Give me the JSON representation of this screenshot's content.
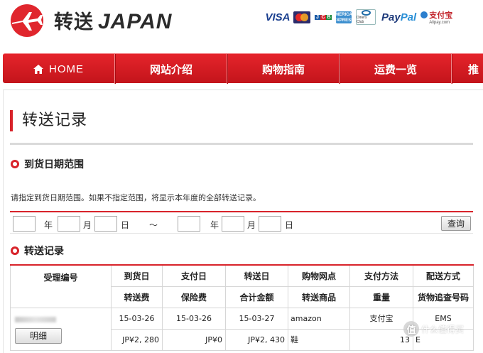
{
  "header": {
    "logo_cn": "转送",
    "logo_en": "JAPAN",
    "payments": {
      "visa": "VISA",
      "jcb": [
        "J",
        "C",
        "B"
      ],
      "amex": "AMERICAN EXPRESS",
      "diners": "Diners Club",
      "paypal_1": "Pay",
      "paypal_2": "Pal",
      "alipay": "支付宝",
      "alipay_sub": "Alipay.com"
    }
  },
  "nav": {
    "items": [
      "HOME",
      "网站介绍",
      "购物指南",
      "运费一览",
      "推"
    ]
  },
  "page": {
    "title": "转送记录",
    "date_section": "到货日期范围",
    "hint": "请指定到货日期范围。如果不指定范围，将显示本年度的全部转送记录。",
    "date_labels": {
      "year": "年",
      "month": "月",
      "day": "日",
      "tilde": "～"
    },
    "search_button": "查询",
    "records_section": "转送记录"
  },
  "table": {
    "header_row1": [
      "受理编号",
      "到货日",
      "支付日",
      "转送日",
      "购物网点",
      "支付方法",
      "配送方式"
    ],
    "header_row2": [
      "转送费",
      "保险费",
      "合计金额",
      "转送商品",
      "重量",
      "货物追查号码"
    ],
    "record": {
      "detail_button": "明细",
      "arrival_date": "15-03-26",
      "payment_date": "15-03-26",
      "transfer_date": "15-03-27",
      "shop": "amazon",
      "payment_method": "支付宝",
      "shipping_method": "EMS",
      "transfer_fee": "JP¥2, 280",
      "insurance_fee": "JP¥0",
      "total_amount": "JP¥2, 430",
      "goods": "鞋",
      "weight": "13",
      "tracking_partial": "E"
    }
  },
  "watermark": {
    "badge": "值",
    "text": "什么值得买"
  },
  "colors": {
    "accent_red": "#d8232a",
    "nav_red": "#e5242b",
    "visa_blue": "#1a3f8f"
  },
  "icons": {
    "logo": "airplane-icon",
    "home": "home-icon",
    "section_bullet": "circle-bullet-icon"
  }
}
